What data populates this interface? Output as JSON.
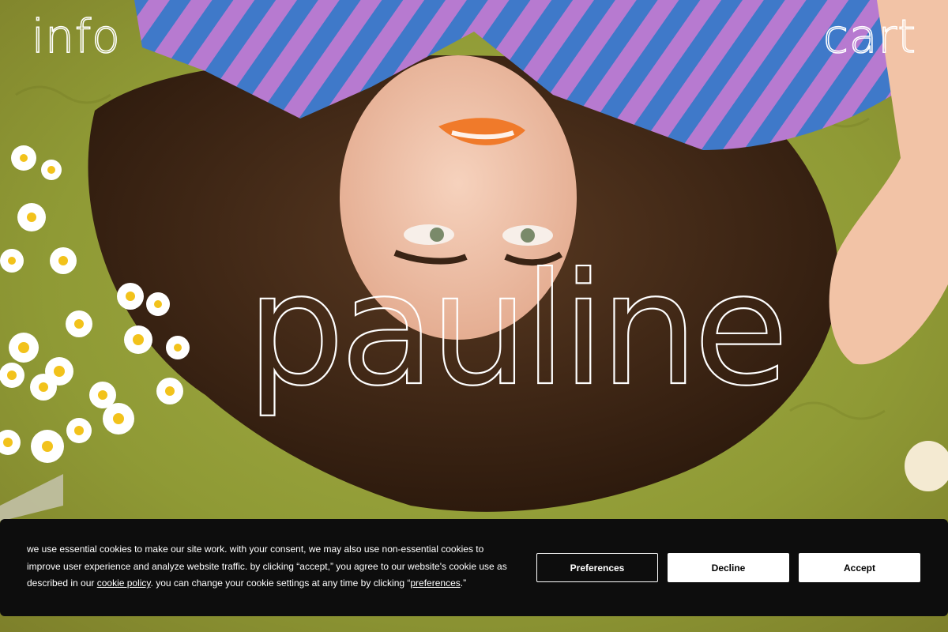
{
  "nav": {
    "info_label": "info",
    "cart_label": "cart"
  },
  "hero": {
    "brand_name": "pauline",
    "photo_icon": "hero-photo",
    "colors": {
      "rug": "#8f9a35",
      "shirt_purple": "#b77ad0",
      "shirt_blue": "#3f79c9",
      "hair": "#3a2415",
      "skin": "#f2c8b0",
      "lips": "#f07a2a"
    }
  },
  "cookie_banner": {
    "text_before_policy": "we use essential cookies to make our site work. with your consent, we may also use non-essential cookies to improve user experience and analyze website traffic. by clicking “accept,” you agree to our website's cookie use as described in our ",
    "policy_link": "cookie policy",
    "text_middle": ". you can change your cookie settings at any time by clicking “",
    "preferences_link": "preferences",
    "text_end": ".”",
    "buttons": {
      "preferences": "Preferences",
      "decline": "Decline",
      "accept": "Accept"
    },
    "background": "#0d0d0d"
  }
}
